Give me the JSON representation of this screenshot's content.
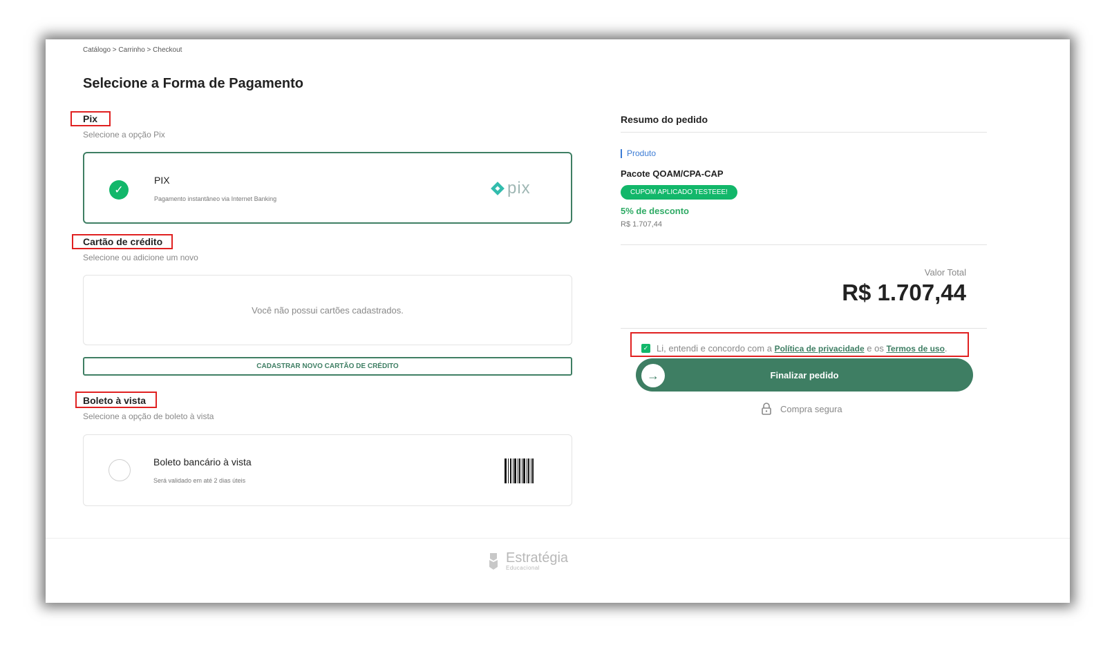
{
  "breadcrumb": "Catálogo > Carrinho > Checkout",
  "page_title": "Selecione a Forma de Pagamento",
  "pix_section": {
    "title": "Pix",
    "subtitle": "Selecione a opção Pix",
    "option_title": "PIX",
    "option_desc": "Pagamento instantâneo via Internet Banking",
    "logo_text": "pix",
    "selected": true
  },
  "card_section": {
    "title": "Cartão de crédito",
    "subtitle": "Selecione ou adicione um novo",
    "empty_message": "Você não possui cartões cadastrados.",
    "add_button": "CADASTRAR NOVO CARTÃO DE CRÉDITO"
  },
  "boleto_section": {
    "title": "Boleto à vista",
    "subtitle": "Selecione a opção de boleto à vista",
    "option_title": "Boleto bancário à vista",
    "option_desc": "Será validado em até 2 dias úteis",
    "selected": false
  },
  "summary": {
    "title": "Resumo do pedido",
    "product_label": "Produto",
    "product_name": "Pacote QOAM/CPA-CAP",
    "coupon": "CUPOM APLICADO TESTEEE!",
    "discount": "5% de desconto",
    "price": "R$ 1.707,44",
    "total_label": "Valor Total",
    "total_value": "R$ 1.707,44"
  },
  "terms": {
    "checked": true,
    "text_before": "Li, entendi e concordo com a",
    "privacy_link": "Política de privacidade",
    "text_middle": "e os",
    "terms_link": "Termos de uso",
    "text_after": "."
  },
  "finalize_button": "Finalizar pedido",
  "secure_label": "Compra segura",
  "footer": {
    "brand": "Estratégia",
    "brand_sub": "Educacional"
  },
  "colors": {
    "primary_green": "#3e7e63",
    "success_green": "#12b76a",
    "annotation_red": "#e02020"
  },
  "icons": [
    "check-icon",
    "pix-logo-icon",
    "barcode-icon",
    "arrow-right-icon",
    "lock-icon",
    "owl-logo-icon"
  ]
}
